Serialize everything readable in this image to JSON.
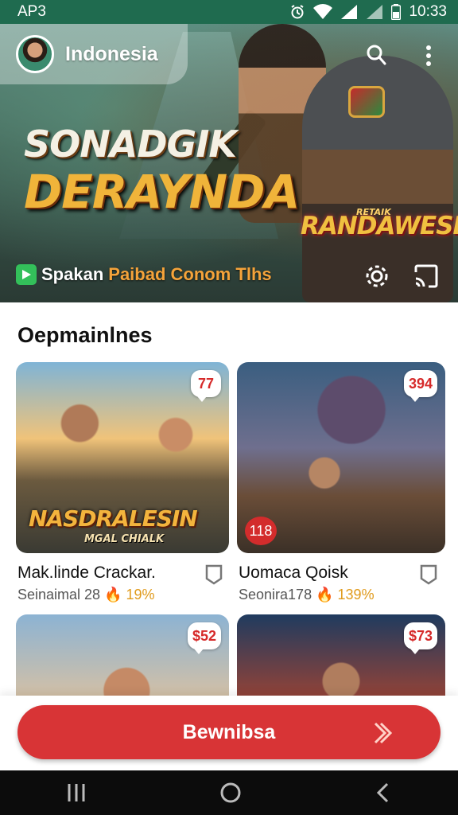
{
  "status_bar": {
    "carrier": "AP3",
    "time": "10:33"
  },
  "hero": {
    "region": "Indonesia",
    "title_line1": "SONADGIK",
    "title_line2": "DERAYNDA",
    "logo_small": "RETAIK",
    "logo_big": "RANDAWESIN",
    "caption_white": "Spakan",
    "caption_orange": "Paibad Conom Tlhs"
  },
  "section": {
    "title": "Oepmainlnes"
  },
  "cards": [
    {
      "name": "Mak.linde Crackar.",
      "meta": "Seinaimal 28",
      "percent": "19%",
      "price": "77",
      "count": "",
      "overlay_big": "NASDRALESIN",
      "overlay_small": "MGAL CHIALK"
    },
    {
      "name": "Uomaca Qoisk",
      "meta": "Seonira178",
      "percent": "139%",
      "price": "394",
      "count": "118"
    },
    {
      "name": "",
      "meta": "",
      "percent": "",
      "price": "$52",
      "count": ""
    },
    {
      "name": "",
      "meta": "",
      "percent": "",
      "price": "$73",
      "count": ""
    }
  ],
  "cta": {
    "label": "Bewnibsa"
  },
  "colors": {
    "accent": "#d83436",
    "status_bar": "#1f6b4f",
    "percent": "#e09a1b"
  },
  "icons": [
    "search-icon",
    "more-vertical-icon",
    "settings-gear-icon",
    "cast-icon",
    "bookmark-icon",
    "chevron-right-icon",
    "recent-apps-icon",
    "home-icon",
    "back-icon"
  ]
}
